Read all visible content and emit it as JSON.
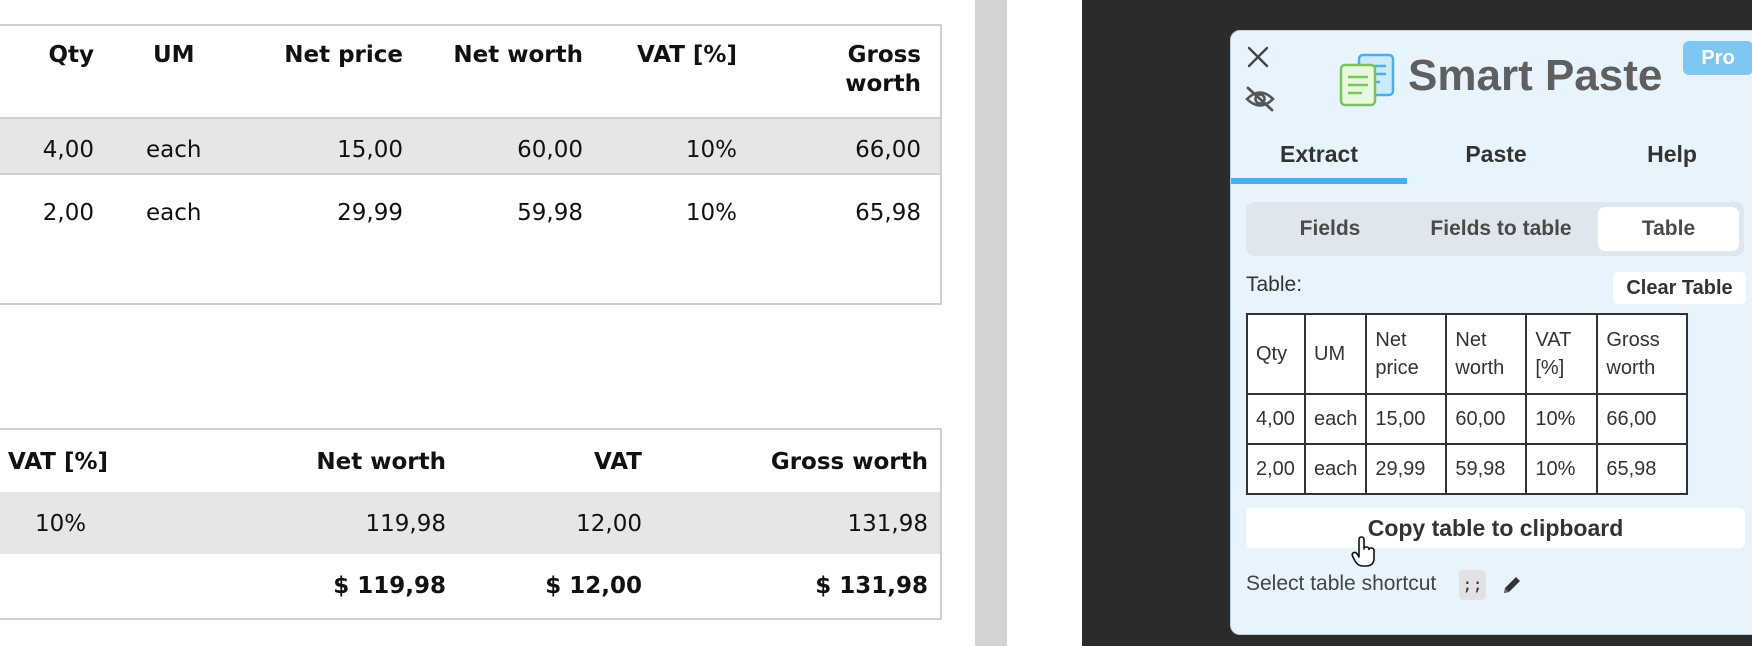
{
  "invoice": {
    "items_table": {
      "headers": [
        "Qty",
        "UM",
        "Net price",
        "Net worth",
        "VAT [%]",
        "Gross",
        "worth"
      ],
      "rows": [
        [
          "4,00",
          "each",
          "15,00",
          "60,00",
          "10%",
          "66,00"
        ],
        [
          "2,00",
          "each",
          "29,99",
          "59,98",
          "10%",
          "65,98"
        ]
      ]
    },
    "summary_table": {
      "headers": [
        "VAT [%]",
        "Net worth",
        "VAT",
        "Gross worth"
      ],
      "row": [
        "10%",
        "119,98",
        "12,00",
        "131,98"
      ],
      "total": [
        "$ 119,98",
        "$ 12,00",
        "$ 131,98"
      ]
    }
  },
  "extension": {
    "title": "Smart Paste",
    "pro_badge": "Pro",
    "tabs": [
      "Extract",
      "Paste",
      "Help"
    ],
    "active_tab": "Extract",
    "modes": [
      "Fields",
      "Fields to table",
      "Table"
    ],
    "active_mode": "Table",
    "table_label": "Table:",
    "clear_label": "Clear Table",
    "preview": [
      [
        "Qty",
        "UM",
        "Net price",
        "Net worth",
        "VAT [%]",
        "Gross worth"
      ],
      [
        "4,00",
        "each",
        "15,00",
        "60,00",
        "10%",
        "66,00"
      ],
      [
        "2,00",
        "each",
        "29,99",
        "59,98",
        "10%",
        "65,98"
      ]
    ],
    "copy_label": "Copy table to clipboard",
    "shortcut_label": "Select table shortcut",
    "shortcut_key": ";;"
  },
  "colors": {
    "accent": "#43b0f1",
    "panel_bg": "#e8f4fd",
    "pro_badge": "#7ec7f3",
    "dark_bg": "#2b2b2b"
  },
  "icons": [
    "close-icon",
    "hide-eye-icon",
    "smart-paste-logo",
    "edit-pencil-icon",
    "hand-cursor-icon"
  ]
}
